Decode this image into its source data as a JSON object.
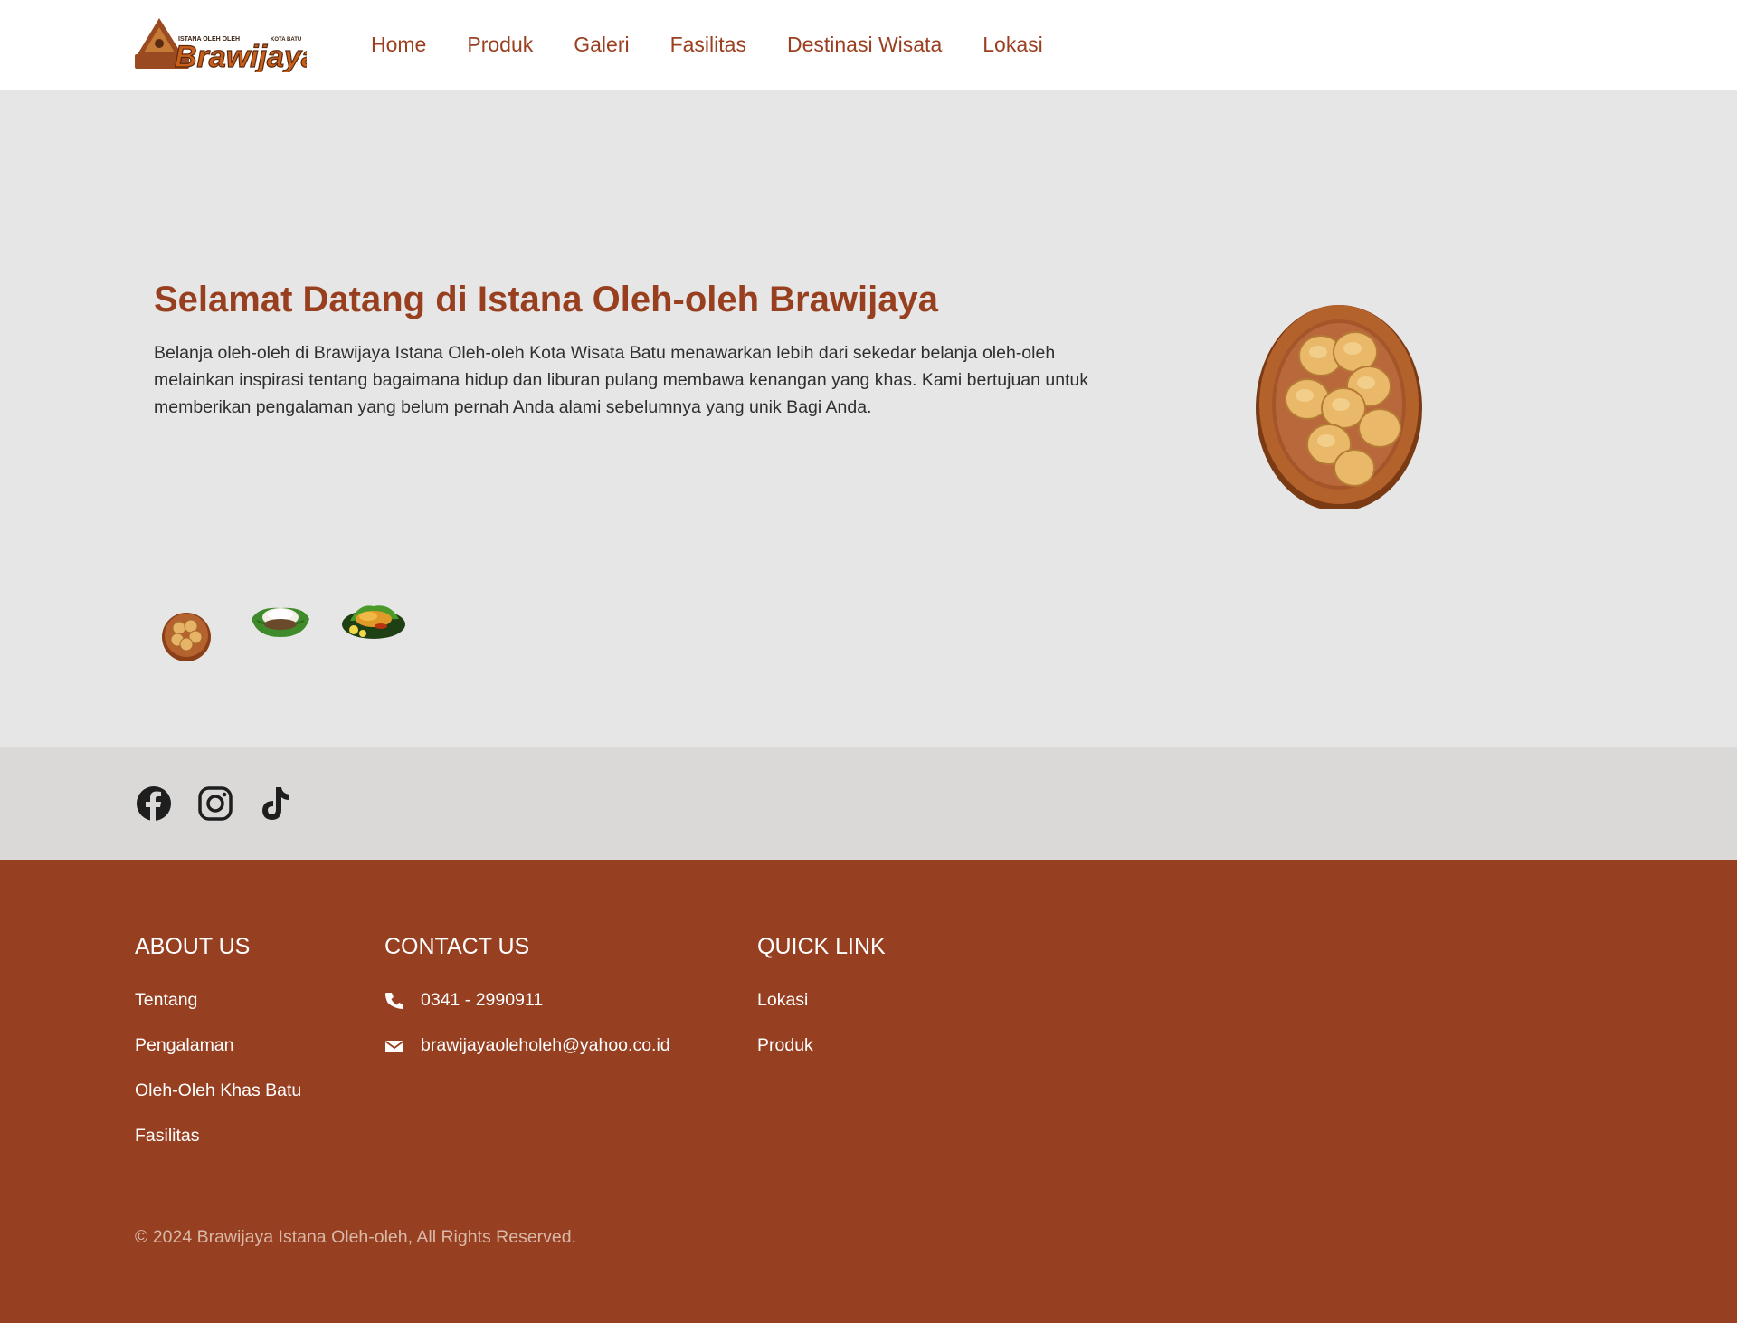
{
  "header": {
    "logo_alt": "Brawijaya",
    "logo_small_left": "ISTANA OLEH OLEH",
    "logo_small_right": "KOTA BATU",
    "logo_main": "Brawijaya",
    "nav": [
      {
        "label": "Home"
      },
      {
        "label": "Produk"
      },
      {
        "label": "Galeri"
      },
      {
        "label": "Fasilitas"
      },
      {
        "label": "Destinasi Wisata"
      },
      {
        "label": "Lokasi"
      }
    ]
  },
  "hero": {
    "title": "Selamat Datang di Istana Oleh-oleh Brawijaya",
    "description": "Belanja oleh-oleh di Brawijaya Istana Oleh-oleh Kota Wisata Batu menawarkan lebih dari sekedar belanja oleh-oleh melainkan inspirasi tentang bagaimana hidup dan liburan pulang membawa kenangan yang khas. Kami bertujuan untuk memberikan pengalaman yang belum pernah Anda alami sebelumnya yang unik Bagi Anda.",
    "image": "bakpia-plate",
    "thumbnails": [
      "bakpia-plate",
      "jenang-on-leaf",
      "fried-snack-on-leaf"
    ]
  },
  "social": {
    "icons": [
      "facebook-icon",
      "instagram-icon",
      "tiktok-icon"
    ]
  },
  "footer": {
    "about": {
      "heading": "ABOUT US",
      "links": [
        "Tentang",
        "Pengalaman",
        "Oleh-Oleh Khas Batu",
        "Fasilitas"
      ]
    },
    "contact": {
      "heading": "CONTACT US",
      "phone": "0341 - 2990911",
      "email": "brawijayaoleholeh@yahoo.co.id"
    },
    "quick": {
      "heading": "QUICK LINK",
      "links": [
        "Lokasi",
        "Produk"
      ]
    },
    "copyright": "© 2024 Brawijaya Istana Oleh-oleh, All Rights Reserved."
  },
  "colors": {
    "brand": "#963f21",
    "nav_text": "#9a3f1f",
    "hero_bg": "#e6e6e6",
    "social_bg": "#dbd8d8"
  }
}
